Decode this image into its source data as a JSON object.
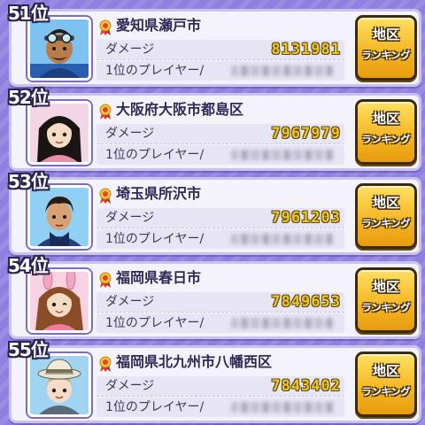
{
  "ranking": {
    "damage_label": "ダメージ",
    "player_label": "1位のプレイヤー/",
    "button_line1": "地区",
    "button_line2": "ランキング",
    "entries": [
      {
        "rank": "51位",
        "city": "愛知県瀬戸市",
        "damage": "8131981",
        "avatar": "avatar-man-goggles"
      },
      {
        "rank": "52位",
        "city": "大阪府大阪市都島区",
        "damage": "7967979",
        "avatar": "avatar-girl-black-hair"
      },
      {
        "rank": "53位",
        "city": "埼玉県所沢市",
        "damage": "7961203",
        "avatar": "avatar-man-hoodie"
      },
      {
        "rank": "54位",
        "city": "福岡県春日市",
        "damage": "7849653",
        "avatar": "avatar-girl-bunny-ears"
      },
      {
        "rank": "55位",
        "city": "福岡県北九州市八幡西区",
        "damage": "7843402",
        "avatar": "avatar-person-hat"
      }
    ]
  },
  "colors": {
    "background": "#8e7fe0",
    "card": "#f4f3fb",
    "damage_value": "#f1c52a",
    "button": "#f4b41f"
  }
}
